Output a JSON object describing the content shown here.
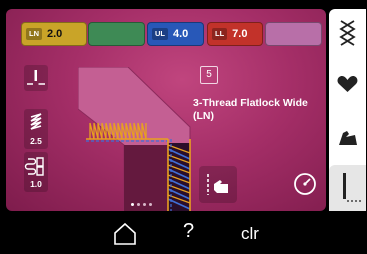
{
  "tension": {
    "looper_needle": {
      "tag": "LN",
      "value": "2.0"
    },
    "upper_looper": {
      "tag": "UL",
      "value": "4.0"
    },
    "lower_looper": {
      "tag": "LL",
      "value": "7.0"
    }
  },
  "stitch": {
    "number": "5",
    "title": "3-Thread Flatlock Wide (LN)"
  },
  "settings": {
    "stitch_length": "2.5",
    "differential_feed": "1.0"
  },
  "bottom_bar": {
    "help": "?",
    "clear": "clr"
  },
  "pagination": {
    "count": 4,
    "active": 0
  },
  "colors": {
    "screen_bg": "#a42e67",
    "ln_yellow": "#c9a428",
    "ul_blue": "#2858b8",
    "ll_red": "#c2322a",
    "green": "#3e8a55",
    "lilac": "#b86fa8"
  },
  "icons": [
    "needle-position-icon",
    "stitch-length-icon",
    "differential-feed-icon",
    "touch-hand-icon",
    "speed-icon",
    "threading-icon",
    "heart-icon",
    "sewing-hand-icon",
    "presser-foot-icon",
    "home-icon"
  ]
}
